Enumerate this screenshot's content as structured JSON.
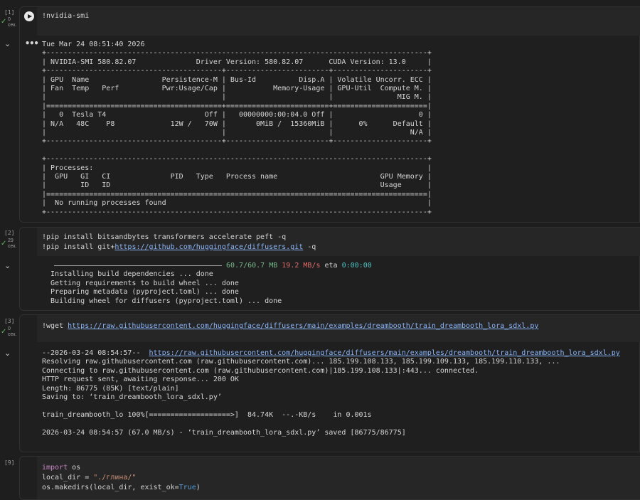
{
  "cells": [
    {
      "exec_count": "[1]",
      "duration": [
        "0",
        "сек."
      ],
      "code": [
        "!nvidia-smi"
      ],
      "output": [
        "Tue Mar 24 08:51:40 2026",
        "+-----------------------------------------------------------------------------------------+",
        "| NVIDIA-SMI 580.82.07              Driver Version: 580.82.07      CUDA Version: 13.0     |",
        "+-----------------------------------------+------------------------+----------------------+",
        "| GPU  Name                 Persistence-M | Bus-Id          Disp.A | Volatile Uncorr. ECC |",
        "| Fan  Temp   Perf          Pwr:Usage/Cap |           Memory-Usage | GPU-Util  Compute M. |",
        "|                                         |                        |               MIG M. |",
        "|=========================================+========================+======================|",
        "|   0  Tesla T4                       Off |   00000000:00:04.0 Off |                    0 |",
        "| N/A   48C    P8             12W /   70W |       0MiB /  15360MiB |      0%      Default |",
        "|                                         |                        |                  N/A |",
        "+-----------------------------------------+------------------------+----------------------+",
        "",
        "+-----------------------------------------------------------------------------------------+",
        "| Processes:                                                                              |",
        "|  GPU   GI   CI              PID   Type   Process name                        GPU Memory |",
        "|        ID   ID                                                               Usage      |",
        "|=========================================================================================|",
        "|  No running processes found                                                             |",
        "+-----------------------------------------------------------------------------------------+"
      ]
    },
    {
      "exec_count": "[2]",
      "duration": [
        "29",
        "сек."
      ],
      "code": [
        "!pip install bitsandbytes transformers accelerate peft -q",
        "!pip install git+",
        "https://github.com/huggingface/diffusers.git",
        " -q"
      ],
      "progress": {
        "size": "60.7/60.7 MB",
        "speed": "19.2 MB/s",
        "eta_label": "eta",
        "eta": "0:00:00"
      },
      "output": [
        "  Installing build dependencies ... done",
        "  Getting requirements to build wheel ... done",
        "  Preparing metadata (pyproject.toml) ... done",
        "  Building wheel for diffusers (pyproject.toml) ... done"
      ]
    },
    {
      "exec_count": "[3]",
      "duration": [
        "0",
        "сек."
      ],
      "code_prefix": "!wget ",
      "code_url": "https://raw.githubusercontent.com/huggingface/diffusers/main/examples/dreambooth/train_dreambooth_lora_sdxl.py",
      "out_first_prefix": "--2026-03-24 08:54:57--  ",
      "out_first_url": "https://raw.githubusercontent.com/huggingface/diffusers/main/examples/dreambooth/train_dreambooth_lora_sdxl.py",
      "output": [
        "Resolving raw.githubusercontent.com (raw.githubusercontent.com)... 185.199.108.133, 185.199.109.133, 185.199.110.133, ...",
        "Connecting to raw.githubusercontent.com (raw.githubusercontent.com)|185.199.108.133|:443... connected.",
        "HTTP request sent, awaiting response... 200 OK",
        "Length: 86775 (85K) [text/plain]",
        "Saving to: ‘train_dreambooth_lora_sdxl.py’",
        "",
        "train_dreambooth_lo 100%[===================>]  84.74K  --.-KB/s    in 0.001s",
        "",
        "2026-03-24 08:54:57 (67.0 MB/s) - ‘train_dreambooth_lora_sdxl.py’ saved [86775/86775]"
      ]
    },
    {
      "exec_count": "[9]",
      "code_l1_kw": "import",
      "code_l1_rest": " os",
      "code_l2_a": "local_dir = ",
      "code_l2_str": "\"./глина/\"",
      "code_l3_a": "os.makedirs(local_dir, exist_ok=",
      "code_l3_bool": "True",
      "code_l3_b": ")"
    }
  ],
  "icons": {
    "run": "play-icon",
    "collapse": "chevron-down-icon",
    "more": "more-dots-icon",
    "done": "check-icon"
  },
  "colors": {
    "background": "#1e1e1e",
    "link": "#8ab4f8",
    "progress_size": "#76b68a",
    "progress_speed": "#e36b6b",
    "progress_eta": "#4fc1c1"
  }
}
